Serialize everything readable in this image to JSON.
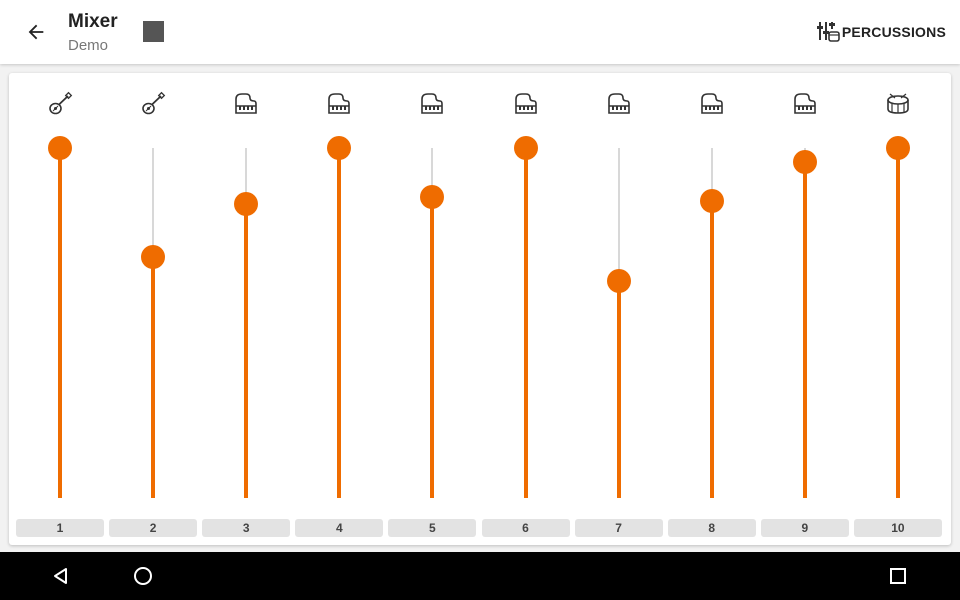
{
  "header": {
    "title": "Mixer",
    "subtitle": "Demo",
    "back_icon": "arrow-left-icon",
    "stop_icon": "stop-icon",
    "percussions_label": "PERCUSSIONS",
    "percussions_icon": "mixer-sliders-drum-icon"
  },
  "accent_color": "#ef6c00",
  "channels": [
    {
      "label": "1",
      "instrument": "guitar-icon",
      "level": 1.0
    },
    {
      "label": "2",
      "instrument": "guitar-icon",
      "level": 0.69
    },
    {
      "label": "3",
      "instrument": "piano-icon",
      "level": 0.84
    },
    {
      "label": "4",
      "instrument": "piano-icon",
      "level": 1.0
    },
    {
      "label": "5",
      "instrument": "piano-icon",
      "level": 0.86
    },
    {
      "label": "6",
      "instrument": "piano-icon",
      "level": 1.0
    },
    {
      "label": "7",
      "instrument": "piano-icon",
      "level": 0.62
    },
    {
      "label": "8",
      "instrument": "piano-icon",
      "level": 0.85
    },
    {
      "label": "9",
      "instrument": "piano-icon",
      "level": 0.96
    },
    {
      "label": "10",
      "instrument": "drum-icon",
      "level": 1.0
    }
  ],
  "system_nav": {
    "back_icon": "nav-back-icon",
    "home_icon": "nav-home-icon",
    "recents_icon": "nav-recents-icon"
  }
}
